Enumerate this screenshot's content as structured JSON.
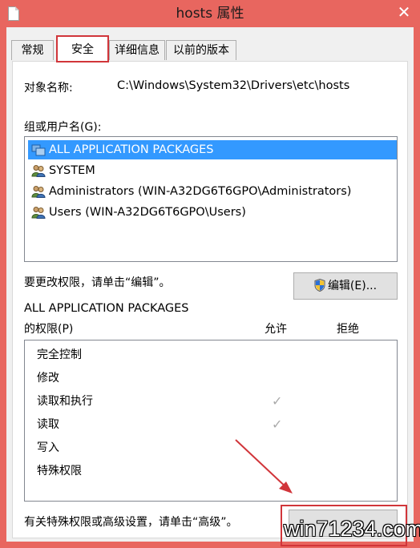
{
  "window": {
    "title": "hosts 属性",
    "close_glyph": "✕",
    "accent": "#e8665f"
  },
  "tabs": [
    {
      "label": "常规"
    },
    {
      "label": "安全"
    },
    {
      "label": "详细信息"
    },
    {
      "label": "以前的版本"
    }
  ],
  "security": {
    "object_name_label": "对象名称:",
    "object_name_value": "C:\\Windows\\System32\\Drivers\\etc\\hosts",
    "group_label": "组或用户名(G):",
    "groups": [
      {
        "name": "ALL APPLICATION PACKAGES",
        "icon": "app-packages-icon",
        "selected": true
      },
      {
        "name": "SYSTEM",
        "icon": "users-icon",
        "selected": false
      },
      {
        "name": "Administrators (WIN-A32DG6T6GPO\\Administrators)",
        "icon": "users-icon",
        "selected": false
      },
      {
        "name": "Users (WIN-A32DG6T6GPO\\Users)",
        "icon": "users-icon",
        "selected": false
      }
    ],
    "change_hint": "要更改权限，请单击“编辑”。",
    "edit_button": "编辑(E)...",
    "perm_title": "ALL APPLICATION PACKAGES",
    "perm_label": "的权限(P)",
    "allow_header": "允许",
    "deny_header": "拒绝",
    "permissions": [
      {
        "name": "完全控制",
        "allow": false,
        "deny": false
      },
      {
        "name": "修改",
        "allow": false,
        "deny": false
      },
      {
        "name": "读取和执行",
        "allow": true,
        "deny": false
      },
      {
        "name": "读取",
        "allow": true,
        "deny": false
      },
      {
        "name": "写入",
        "allow": false,
        "deny": false
      },
      {
        "name": "特殊权限",
        "allow": false,
        "deny": false
      }
    ],
    "advanced_hint": "有关特殊权限或高级设置，请单击“高级”。",
    "advanced_button": ""
  },
  "watermark": "win71234.com",
  "highlight_color": "#d1353a"
}
